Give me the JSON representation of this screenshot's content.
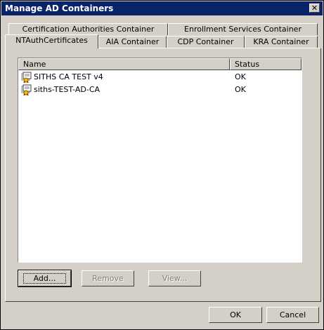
{
  "window": {
    "title": "Manage AD Containers"
  },
  "tabs_back": [
    "Certification Authorities Container",
    "Enrollment Services Container"
  ],
  "tabs_front": [
    "NTAuthCertificates",
    "AIA Container",
    "CDP Container",
    "KRA Container"
  ],
  "active_tab": "NTAuthCertificates",
  "list": {
    "columns": [
      "Name",
      "Status"
    ],
    "rows": [
      {
        "name": "SITHS CA TEST v4",
        "status": "OK",
        "icon": "certificate-icon"
      },
      {
        "name": "siths-TEST-AD-CA",
        "status": "OK",
        "icon": "certificate-icon"
      }
    ]
  },
  "buttons": {
    "add": "Add...",
    "remove": "Remove",
    "view": "View...",
    "ok": "OK",
    "cancel": "Cancel"
  },
  "close_glyph": "✕"
}
